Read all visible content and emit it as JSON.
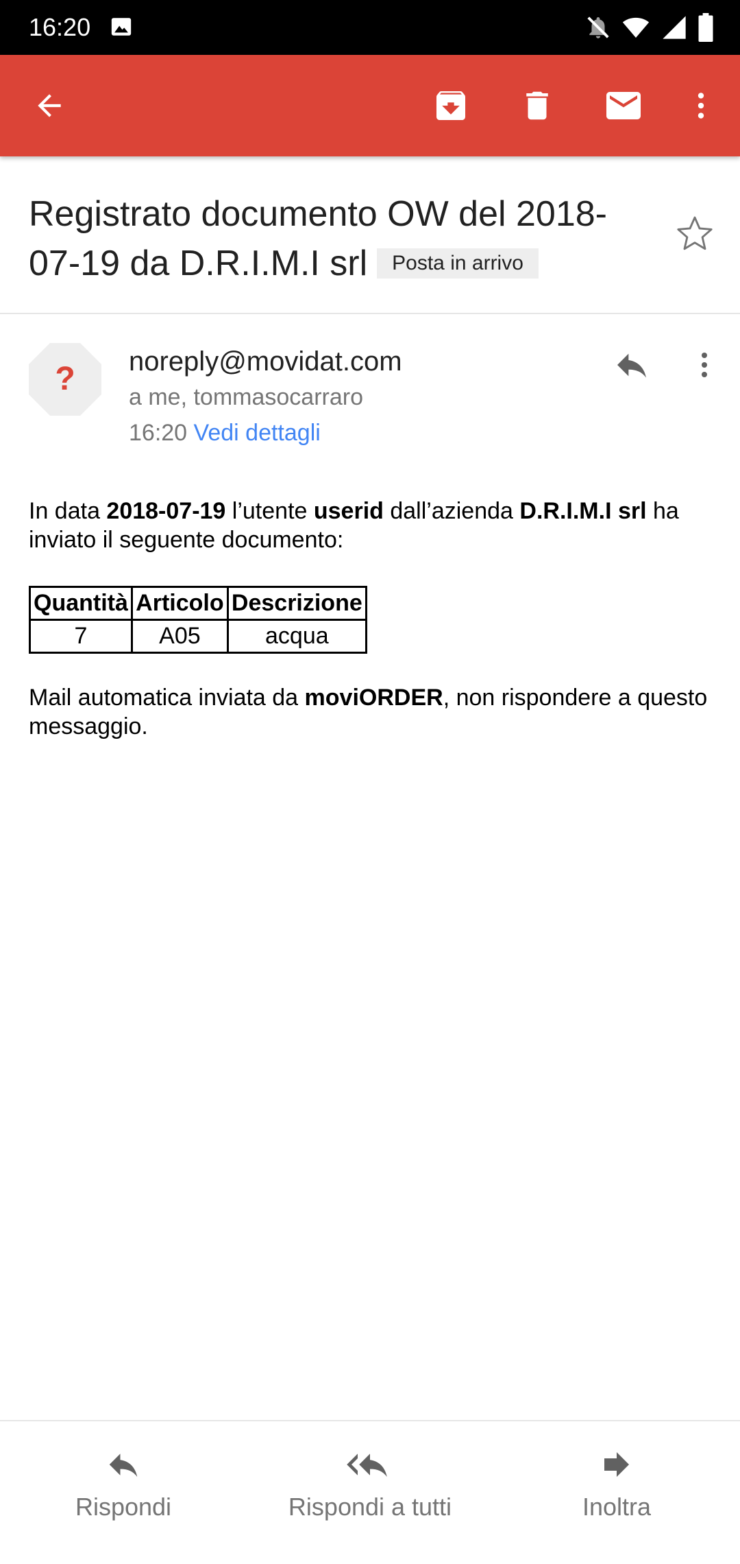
{
  "status_bar": {
    "time": "16:20"
  },
  "app_bar": {
    "actions": [
      "back",
      "archive",
      "delete",
      "mark-unread",
      "more"
    ]
  },
  "email": {
    "subject": "Registrato documento OW del 2018-07-19 da D.R.I.M.I srl",
    "label": "Posta in arrivo",
    "sender": "noreply@movidat.com",
    "recipients": "a me, tommasocarraro",
    "time": "16:20",
    "details_link": "Vedi dettagli",
    "avatar_glyph": "?",
    "body": {
      "intro_1": "In data ",
      "date": "2018-07-19",
      "intro_2": " l’utente ",
      "user": "userid",
      "intro_3": " dall’azienda ",
      "company": "D.R.I.M.I srl",
      "intro_4": " ha inviato il seguente documento:",
      "table": {
        "headers": [
          "Quantità",
          "Articolo",
          "Descrizione"
        ],
        "rows": [
          [
            "7",
            "A05",
            "acqua"
          ]
        ]
      },
      "footer_1": "Mail automatica inviata da ",
      "footer_app": "moviORDER",
      "footer_2": ", non rispondere a questo messaggio."
    }
  },
  "bottom_actions": {
    "reply": "Rispondi",
    "reply_all": "Rispondi a tutti",
    "forward": "Inoltra"
  },
  "colors": {
    "app_bar": "#db4437",
    "link": "#4285f4",
    "avatar_bg": "#eeeeee",
    "avatar_glyph": "#db4437"
  }
}
